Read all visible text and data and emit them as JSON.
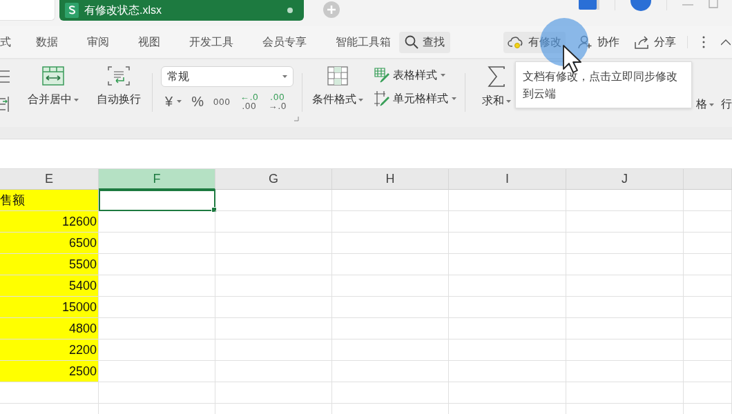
{
  "document_tab": {
    "title": "有修改状态.xlsx",
    "selected": true,
    "modified": true
  },
  "menu": {
    "items": [
      {
        "label": "式",
        "selected": false
      },
      {
        "label": "数据",
        "selected": false
      },
      {
        "label": "审阅",
        "selected": false
      },
      {
        "label": "视图",
        "selected": false
      },
      {
        "label": "开发工具",
        "selected": false
      },
      {
        "label": "会员专享",
        "selected": false
      },
      {
        "label": "智能工具箱",
        "selected": false
      }
    ],
    "search": {
      "label": "查找"
    },
    "actions": [
      {
        "kind": "cloud",
        "label": "有修改"
      },
      {
        "kind": "collab",
        "label": "协作"
      },
      {
        "kind": "share",
        "label": "分享"
      }
    ]
  },
  "ribbon": {
    "left": [
      {
        "kind": "merge",
        "label": "合并居中",
        "dropdown": true
      },
      {
        "kind": "wrap",
        "label": "自动换行",
        "dropdown": false
      }
    ],
    "number_format": {
      "value": "常规"
    },
    "number_buttons": [
      {
        "kind": "currency",
        "label": "¥",
        "dropdown": true
      },
      {
        "kind": "percent",
        "label": "%"
      },
      {
        "kind": "thousands",
        "label": "000"
      },
      {
        "kind": "decimal",
        "top": "←.0",
        "bottom": ".00"
      },
      {
        "kind": "decimal",
        "top": ".00",
        "bottom": "→.0"
      }
    ],
    "conditional": {
      "label": "条件格式",
      "dropdown": true
    },
    "styles": [
      {
        "kind": "table",
        "label": "表格样式",
        "dropdown": true
      },
      {
        "kind": "cell",
        "label": "单元格样式",
        "dropdown": true
      }
    ],
    "sum": {
      "label": "求和",
      "dropdown": true
    },
    "right": [
      {
        "label": "格",
        "dropdown": true
      },
      {
        "label": "行",
        "dropdown": false
      }
    ]
  },
  "tooltip": {
    "text": "文档有修改，点击立即同步修改到云端"
  },
  "grid": {
    "columns": [
      {
        "label": "E",
        "selected": false
      },
      {
        "label": "F",
        "selected": true
      },
      {
        "label": "G",
        "selected": false
      },
      {
        "label": "H",
        "selected": false
      },
      {
        "label": "I",
        "selected": false
      },
      {
        "label": "J",
        "selected": false
      }
    ],
    "rows": [
      {
        "e": "售额",
        "highlighted": true,
        "f_selected": true
      },
      {
        "e": "12600",
        "highlighted": true,
        "f_selected": false
      },
      {
        "e": "6500",
        "highlighted": true,
        "f_selected": false
      },
      {
        "e": "5500",
        "highlighted": true,
        "f_selected": false
      },
      {
        "e": "5400",
        "highlighted": true,
        "f_selected": false
      },
      {
        "e": "15000",
        "highlighted": true,
        "f_selected": false
      },
      {
        "e": "4800",
        "highlighted": true,
        "f_selected": false
      },
      {
        "e": "2200",
        "highlighted": true,
        "f_selected": false
      },
      {
        "e": "2500",
        "highlighted": true,
        "f_selected": false
      },
      {
        "highlighted": false,
        "f_selected": false
      },
      {
        "highlighted": false,
        "f_selected": false
      }
    ]
  }
}
